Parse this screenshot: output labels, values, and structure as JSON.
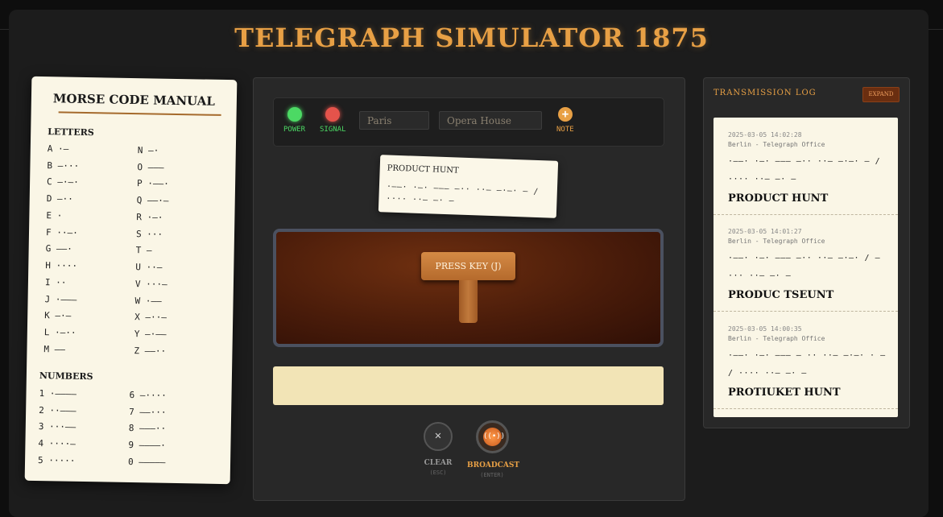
{
  "app": {
    "title": "TELEGRAPH SIMULATOR 1875"
  },
  "manual": {
    "title": "MORSE CODE MANUAL",
    "letters_heading": "LETTERS",
    "numbers_heading": "NUMBERS",
    "letters_left": [
      "A ·–",
      "B –···",
      "C –·–·",
      "D –··",
      "E ·",
      "F ··–·",
      "G ––·",
      "H ····",
      "I ··",
      "J ·–––",
      "K –·–",
      "L ·–··",
      "M ––"
    ],
    "letters_right": [
      "N –·",
      "O –––",
      "P ·––·",
      "Q ––·–",
      "R ·–·",
      "S ···",
      "T –",
      "U ··–",
      "V ···–",
      "W ·––",
      "X –··–",
      "Y –·––",
      "Z ––··"
    ],
    "numbers_left": [
      "1 ·––––",
      "2 ··–––",
      "3 ···––",
      "4 ····–",
      "5 ·····"
    ],
    "numbers_right": [
      "6 –····",
      "7 ––···",
      "8 –––··",
      "9 ––––·",
      "0 –––––"
    ]
  },
  "controls": {
    "power_label": "POWER",
    "signal_label": "SIGNAL",
    "city_value": "Paris",
    "location_value": "Opera House",
    "note_label": "NOTE",
    "note_glyph": "+"
  },
  "note": {
    "title": "PRODUCT HUNT",
    "code": "·––· ·–· ––– –·· ··– –·–· – / ···· ··– –· –"
  },
  "key": {
    "label": "PRESS KEY (J)"
  },
  "output": {
    "text": ""
  },
  "actions": {
    "clear_label": "CLEAR",
    "clear_hint": "(ESC)",
    "clear_glyph": "✕",
    "broadcast_label": "BROADCAST",
    "broadcast_hint": "(ENTER)",
    "broadcast_glyph": "((•))"
  },
  "log": {
    "title": "TRANSMISSION LOG",
    "expand_label": "EXPAND",
    "entries": [
      {
        "time": "2025-03-05 14:02:28",
        "location": "Berlin - Telegraph Office",
        "code": "·––· ·–· ––– –·· ··– –·–· – / ···· ··– –· –",
        "message": "PRODUCT HUNT"
      },
      {
        "time": "2025-03-05 14:01:27",
        "location": "Berlin - Telegraph Office",
        "code": "·––· ·–· ––– –·· ··– –·–· / – ··· ··– –· –",
        "message": "PRODUC TSEUNT"
      },
      {
        "time": "2025-03-05 14:00:35",
        "location": "Berlin - Telegraph Office",
        "code": "·––· ·–· ––– – ·· ··– –·–· · – / ···· ··– –· –",
        "message": "PROTIUKET HUNT"
      }
    ]
  },
  "colors": {
    "accent": "#e8a045",
    "power_led": "#4cd964",
    "signal_led": "#e5534b",
    "paper": "#faf6e6"
  }
}
